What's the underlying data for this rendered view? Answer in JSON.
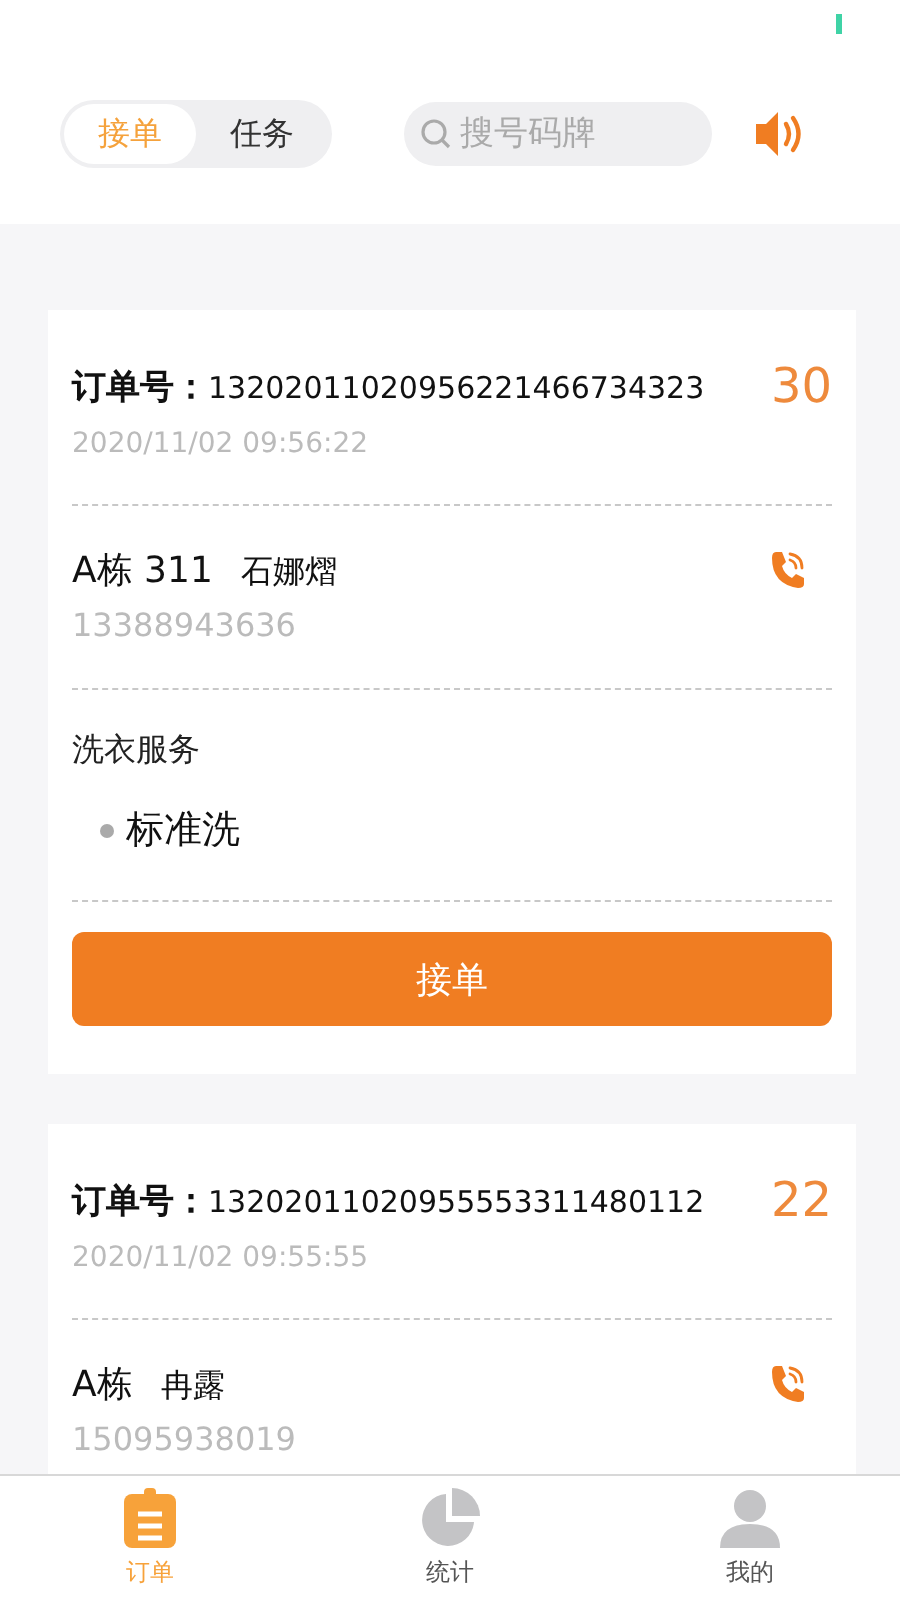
{
  "segments": [
    {
      "label": "接单",
      "selected": true
    },
    {
      "label": "任务",
      "selected": false
    }
  ],
  "search": {
    "placeholder": "搜号码牌"
  },
  "orders": [
    {
      "label": "订单号：",
      "number": "13202011020956221466734323",
      "countdown": "30",
      "time": "2020/11/02 09:56:22",
      "address": "A栋 311",
      "customer": "石娜熠",
      "phone": "13388943636",
      "service_title": "洗衣服务",
      "services": [
        "标准洗"
      ],
      "button": "接单"
    },
    {
      "label": "订单号：",
      "number": "13202011020955553311480112",
      "countdown": "22",
      "time": "2020/11/02 09:55:55",
      "address": "A栋",
      "customer": "冉露",
      "phone": "15095938019"
    }
  ],
  "tabbar": [
    {
      "kind": "orders",
      "label": "订单",
      "selected": true
    },
    {
      "kind": "stats",
      "label": "统计",
      "selected": false
    },
    {
      "kind": "profile",
      "label": "我的",
      "selected": false
    }
  ]
}
